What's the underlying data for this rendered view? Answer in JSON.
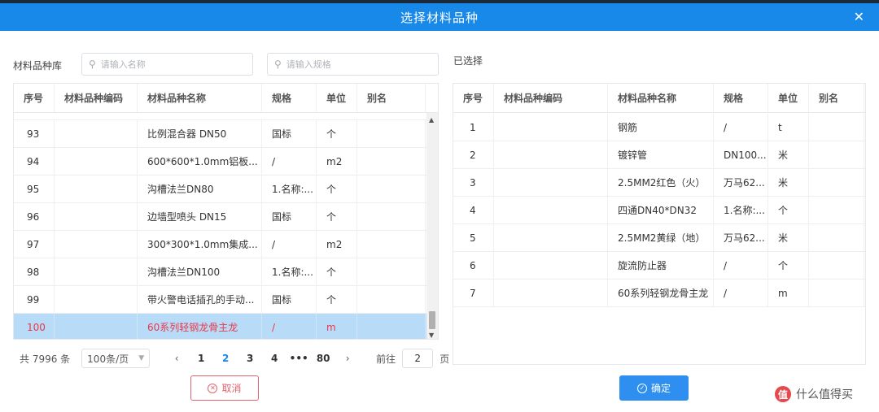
{
  "dialog": {
    "title": "选择材料品种",
    "close_icon": "close-icon"
  },
  "left": {
    "label": "材料品种库",
    "search_name_placeholder": "请输入名称",
    "search_spec_placeholder": "请输入规格",
    "columns": [
      "序号",
      "材料品种编码",
      "材料品种名称",
      "规格",
      "单位",
      "别名"
    ],
    "rows": [
      [
        "93",
        "",
        "比例混合器 DN50",
        "国标",
        "个",
        ""
      ],
      [
        "94",
        "",
        "600*600*1.0mm铝板...",
        "/",
        "m2",
        ""
      ],
      [
        "95",
        "",
        "沟槽法兰DN80",
        "1.名称:...",
        "个",
        ""
      ],
      [
        "96",
        "",
        "边墙型喷头 DN15",
        "国标",
        "个",
        ""
      ],
      [
        "97",
        "",
        "300*300*1.0mm集成...",
        "/",
        "m2",
        ""
      ],
      [
        "98",
        "",
        "沟槽法兰DN100",
        "1.名称:...",
        "个",
        ""
      ],
      [
        "99",
        "",
        "带火警电话插孔的手动...",
        "国标",
        "个",
        ""
      ],
      [
        "100",
        "",
        "60系列轻钢龙骨主龙",
        "/",
        "m",
        ""
      ]
    ],
    "selected_index": 7
  },
  "right": {
    "label": "已选择",
    "columns": [
      "序号",
      "材料品种编码",
      "材料品种名称",
      "规格",
      "单位",
      "别名"
    ],
    "rows": [
      [
        "1",
        "",
        "钢筋",
        "/",
        "t",
        ""
      ],
      [
        "2",
        "",
        "镀锌管",
        "DN100...",
        "米",
        ""
      ],
      [
        "3",
        "",
        "2.5MM2红色（火）",
        "万马62...",
        "米",
        ""
      ],
      [
        "4",
        "",
        "四通DN40*DN32",
        "1.名称:...",
        "个",
        ""
      ],
      [
        "5",
        "",
        "2.5MM2黄绿（地）",
        "万马62...",
        "米",
        ""
      ],
      [
        "6",
        "",
        "旋流防止器",
        "/",
        "个",
        ""
      ],
      [
        "7",
        "",
        "60系列轻钢龙骨主龙",
        "/",
        "m",
        ""
      ]
    ]
  },
  "pager": {
    "total": "共 7996 条",
    "page_size": "100条/页",
    "pages": [
      "1",
      "2",
      "3",
      "4",
      "•••",
      "80"
    ],
    "active_page": "2",
    "goto_label": "前往",
    "goto_value": "2",
    "goto_unit": "页"
  },
  "buttons": {
    "cancel": "取消",
    "confirm": "确定"
  },
  "logo_text": "什么值得买",
  "logo_mark": "值",
  "colors": {
    "header": "#1889e9",
    "selected_row": "#b8dcf8",
    "selected_text": "#e9374a",
    "cancel": "#e0636d",
    "confirm": "#2f8ff0"
  }
}
